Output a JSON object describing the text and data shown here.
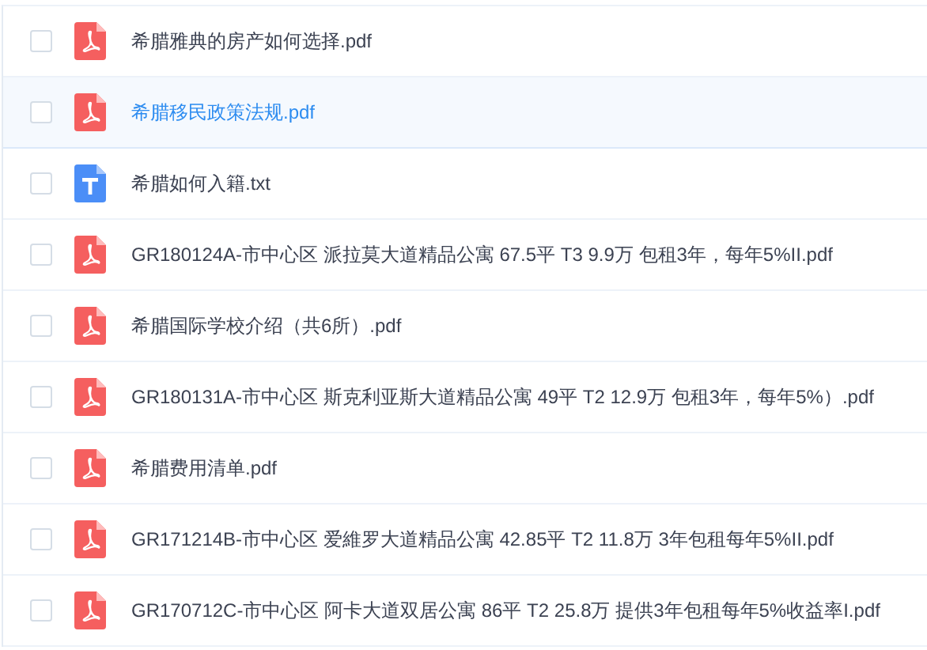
{
  "files": [
    {
      "name": "希腊雅典的房产如何选择.pdf",
      "kind": "pdf",
      "checked": false,
      "highlighted": false
    },
    {
      "name": "希腊移民政策法规.pdf",
      "kind": "pdf",
      "checked": false,
      "highlighted": true
    },
    {
      "name": "希腊如何入籍.txt",
      "kind": "txt",
      "checked": false,
      "highlighted": false
    },
    {
      "name": "GR180124A-市中心区 派拉莫大道精品公寓 67.5平 T3 9.9万 包租3年，每年5%II.pdf",
      "kind": "pdf",
      "checked": false,
      "highlighted": false
    },
    {
      "name": "希腊国际学校介绍（共6所）.pdf",
      "kind": "pdf",
      "checked": false,
      "highlighted": false
    },
    {
      "name": "GR180131A-市中心区 斯克利亚斯大道精品公寓 49平 T2 12.9万 包租3年，每年5%）.pdf",
      "kind": "pdf",
      "checked": false,
      "highlighted": false
    },
    {
      "name": "希腊费用清单.pdf",
      "kind": "pdf",
      "checked": false,
      "highlighted": false
    },
    {
      "name": "GR171214B-市中心区 爱維罗大道精品公寓 42.85平 T2 11.8万 3年包租每年5%II.pdf",
      "kind": "pdf",
      "checked": false,
      "highlighted": false
    },
    {
      "name": "GR170712C-市中心区 阿卡大道双居公寓 86平 T2 25.8万 提供3年包租每年5%收益率I.pdf",
      "kind": "pdf",
      "checked": false,
      "highlighted": false
    }
  ]
}
